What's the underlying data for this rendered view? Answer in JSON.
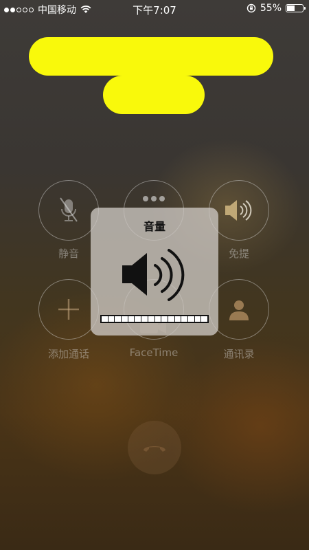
{
  "status_bar": {
    "carrier": "中国移动",
    "time": "下午7:07",
    "battery_percent_text": "55%",
    "battery_level": 0.55,
    "signal_strength": 2,
    "signal_total": 5
  },
  "call_buttons": [
    {
      "id": "mute",
      "label": "静音",
      "icon": "mic-muted-icon"
    },
    {
      "id": "keypad",
      "label": "",
      "icon": "keypad-icon"
    },
    {
      "id": "speaker",
      "label": "免提",
      "icon": "speaker-icon"
    },
    {
      "id": "add_call",
      "label": "添加通话",
      "icon": "plus-icon"
    },
    {
      "id": "facetime",
      "label": "FaceTime",
      "icon": "facetime-icon"
    },
    {
      "id": "contacts",
      "label": "通讯录",
      "icon": "contacts-icon"
    }
  ],
  "volume_hud": {
    "title": "音量",
    "level": 1.0,
    "segments": 16
  },
  "colors": {
    "redaction": "#f9f90b",
    "hud_bg": "#cdc8c3"
  }
}
